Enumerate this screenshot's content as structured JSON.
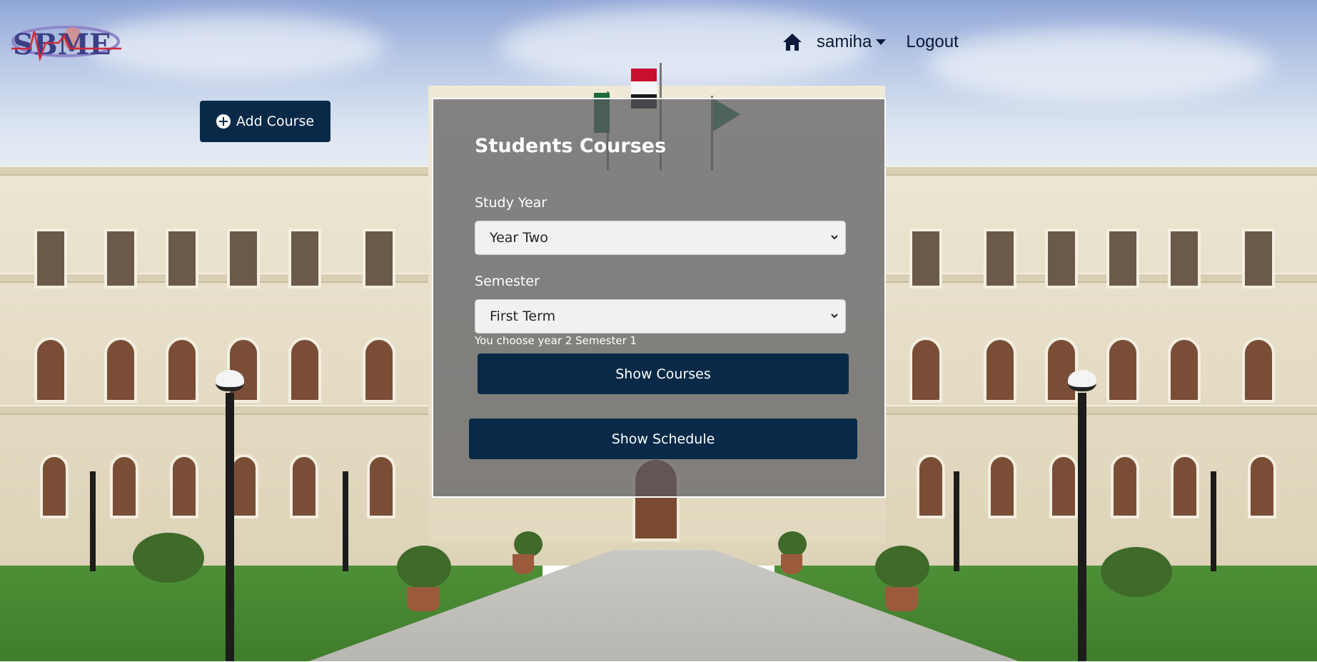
{
  "brand": {
    "logo_text": "SBME"
  },
  "nav": {
    "home_icon": "home-icon",
    "user_label": "samiha",
    "logout_label": "Logout"
  },
  "toolbar": {
    "add_course_label": "Add Course",
    "add_course_icon": "plus-circle-icon"
  },
  "panel": {
    "title": "Students Courses",
    "study_year": {
      "label": "Study Year",
      "value": "Year Two"
    },
    "semester": {
      "label": "Semester",
      "value": "First Term"
    },
    "hint": "You choose year 2 Semester 1",
    "show_courses_label": "Show Courses",
    "show_schedule_label": "Show Schedule"
  },
  "colors": {
    "button_bg": "#082a48",
    "nav_text": "#0c1a3a",
    "panel_overlay": "rgba(90,90,95,0.72)"
  }
}
